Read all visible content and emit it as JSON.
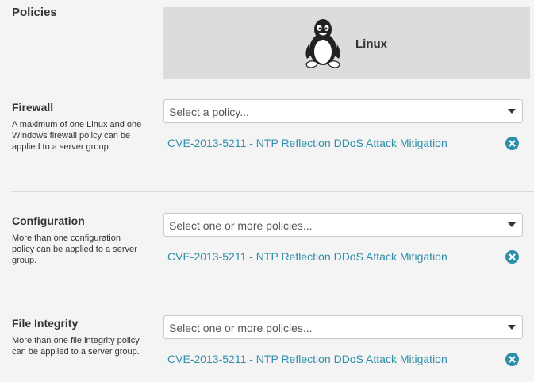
{
  "page": {
    "title": "Policies"
  },
  "os_card": {
    "label": "Linux",
    "icon": "linux-tux-icon"
  },
  "sections": [
    {
      "title": "Firewall",
      "description": "A maximum of one Linux and one Windows firewall policy can be applied to a server group.",
      "placeholder": "Select a policy...",
      "selected_policy": "CVE-2013-5211 - NTP Reflection DDoS Attack Mitigation"
    },
    {
      "title": "Configuration",
      "description": "More than one configuration policy can be applied to a server group.",
      "placeholder": "Select one or more policies...",
      "selected_policy": "CVE-2013-5211 - NTP Reflection DDoS Attack Mitigation"
    },
    {
      "title": "File Integrity",
      "description": "More than one file integrity policy can be applied to a server group.",
      "placeholder": "Select one or more policies...",
      "selected_policy": "CVE-2013-5211 - NTP Reflection DDoS Attack Mitigation"
    }
  ],
  "colors": {
    "link": "#2f8ea8",
    "remove_icon": "#2f8ea8",
    "card_bg": "#dcdcdc"
  }
}
